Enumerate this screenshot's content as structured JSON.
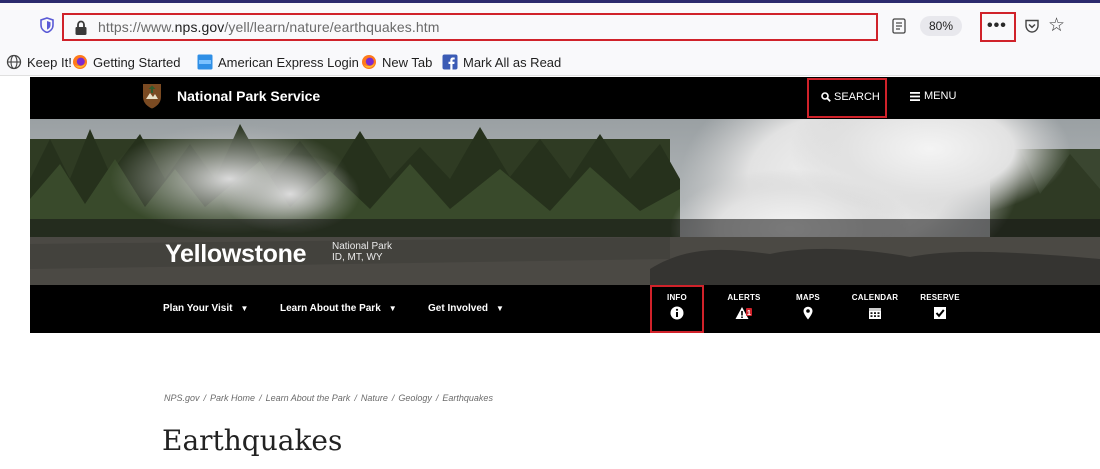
{
  "browser": {
    "url_prefix": "https://www.",
    "url_domain": "nps.gov",
    "url_path": "/yell/learn/nature/earthquakes.htm",
    "zoom": "80%",
    "more_label": "•••",
    "bookmarks": [
      {
        "label": "Keep It!",
        "icon": "globe-icon"
      },
      {
        "label": "Getting Started",
        "icon": "firefox-icon"
      },
      {
        "label": "American Express Login",
        "icon": "amex-icon"
      },
      {
        "label": "New Tab",
        "icon": "firefox-icon"
      },
      {
        "label": "Mark All as Read",
        "icon": "facebook-icon"
      }
    ],
    "highlight_color": "#d0222a"
  },
  "nps": {
    "site_name": "National Park Service",
    "search_label": "SEARCH",
    "menu_label": "MENU",
    "park_name": "Yellowstone",
    "park_type": "National Park",
    "park_states": "ID, MT, WY",
    "nav": [
      {
        "label": "Plan Your Visit"
      },
      {
        "label": "Learn About the Park"
      },
      {
        "label": "Get Involved"
      }
    ],
    "quick_links": [
      {
        "label": "INFO",
        "icon": "info-icon"
      },
      {
        "label": "ALERTS",
        "icon": "alert-icon",
        "badge": "1"
      },
      {
        "label": "MAPS",
        "icon": "map-pin-icon"
      },
      {
        "label": "CALENDAR",
        "icon": "calendar-icon"
      },
      {
        "label": "RESERVE",
        "icon": "checkbox-icon"
      }
    ]
  },
  "page": {
    "breadcrumb": [
      "NPS.gov",
      "Park Home",
      "Learn About the Park",
      "Nature",
      "Geology",
      "Earthquakes"
    ],
    "title": "Earthquakes"
  }
}
